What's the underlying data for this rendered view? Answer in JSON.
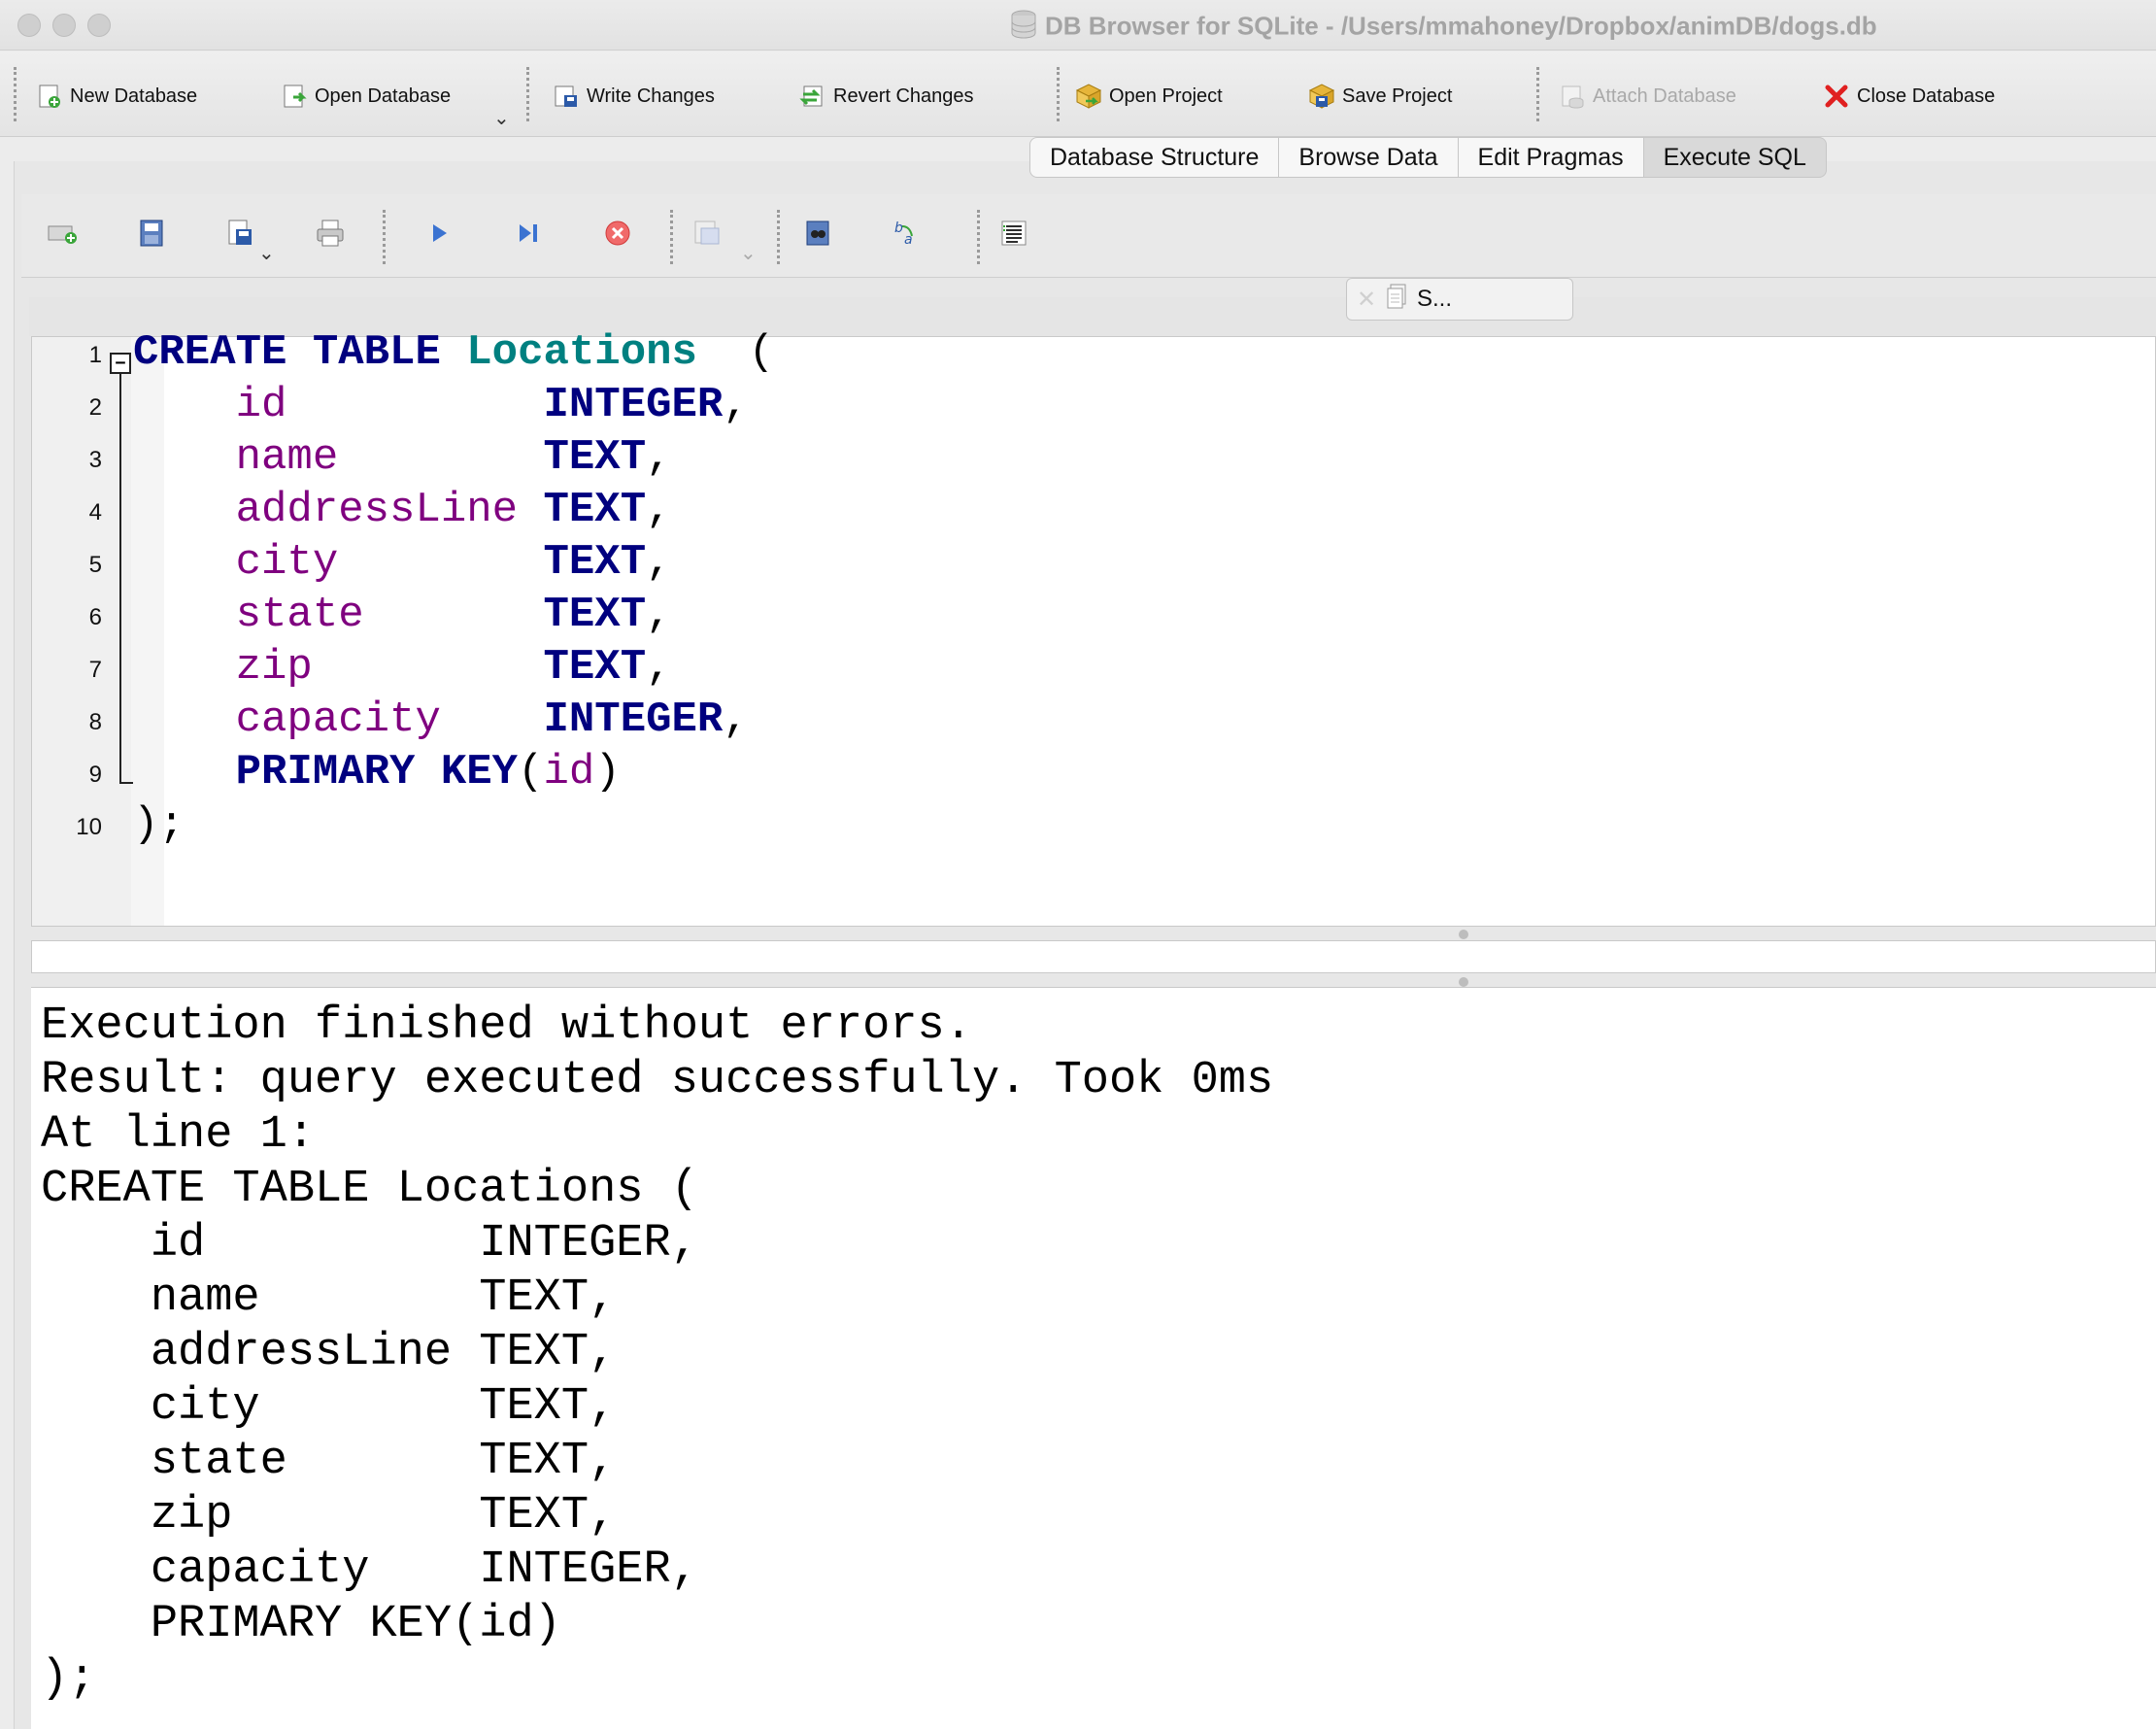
{
  "window": {
    "title": "DB Browser for SQLite - /Users/mmahoney/Dropbox/animDB/dogs.db"
  },
  "toolbar": {
    "new_database": "New Database",
    "open_database": "Open Database",
    "write_changes": "Write Changes",
    "revert_changes": "Revert Changes",
    "open_project": "Open Project",
    "save_project": "Save Project",
    "attach_database": "Attach Database",
    "close_database": "Close Database"
  },
  "tabs": [
    {
      "label": "Database Structure",
      "active": false
    },
    {
      "label": "Browse Data",
      "active": false
    },
    {
      "label": "Edit Pragmas",
      "active": false
    },
    {
      "label": "Execute SQL",
      "active": true
    }
  ],
  "editor": {
    "tab_label": "S...",
    "line_numbers": [
      "1",
      "2",
      "3",
      "4",
      "5",
      "6",
      "7",
      "8",
      "9",
      "10"
    ],
    "code": [
      [
        {
          "t": "CREATE",
          "c": "kw"
        },
        {
          "t": " ",
          "c": "pn"
        },
        {
          "t": "TABLE",
          "c": "kw"
        },
        {
          "t": " ",
          "c": "pn"
        },
        {
          "t": "Locations",
          "c": "tbl"
        },
        {
          "t": "  (",
          "c": "pn"
        }
      ],
      [
        {
          "t": "    ",
          "c": "pn"
        },
        {
          "t": "id",
          "c": "col"
        },
        {
          "t": "          ",
          "c": "pn"
        },
        {
          "t": "INTEGER",
          "c": "kw"
        },
        {
          "t": ",",
          "c": "pn"
        }
      ],
      [
        {
          "t": "    ",
          "c": "pn"
        },
        {
          "t": "name",
          "c": "col"
        },
        {
          "t": "        ",
          "c": "pn"
        },
        {
          "t": "TEXT",
          "c": "kw"
        },
        {
          "t": ",",
          "c": "pn"
        }
      ],
      [
        {
          "t": "    ",
          "c": "pn"
        },
        {
          "t": "addressLine",
          "c": "col"
        },
        {
          "t": " ",
          "c": "pn"
        },
        {
          "t": "TEXT",
          "c": "kw"
        },
        {
          "t": ",",
          "c": "pn"
        }
      ],
      [
        {
          "t": "    ",
          "c": "pn"
        },
        {
          "t": "city",
          "c": "col"
        },
        {
          "t": "        ",
          "c": "pn"
        },
        {
          "t": "TEXT",
          "c": "kw"
        },
        {
          "t": ",",
          "c": "pn"
        }
      ],
      [
        {
          "t": "    ",
          "c": "pn"
        },
        {
          "t": "state",
          "c": "col"
        },
        {
          "t": "       ",
          "c": "pn"
        },
        {
          "t": "TEXT",
          "c": "kw"
        },
        {
          "t": ",",
          "c": "pn"
        }
      ],
      [
        {
          "t": "    ",
          "c": "pn"
        },
        {
          "t": "zip",
          "c": "col"
        },
        {
          "t": "         ",
          "c": "pn"
        },
        {
          "t": "TEXT",
          "c": "kw"
        },
        {
          "t": ",",
          "c": "pn"
        }
      ],
      [
        {
          "t": "    ",
          "c": "pn"
        },
        {
          "t": "capacity",
          "c": "col"
        },
        {
          "t": "    ",
          "c": "pn"
        },
        {
          "t": "INTEGER",
          "c": "kw"
        },
        {
          "t": ",",
          "c": "pn"
        }
      ],
      [
        {
          "t": "    ",
          "c": "pn"
        },
        {
          "t": "PRIMARY",
          "c": "kw"
        },
        {
          "t": " ",
          "c": "pn"
        },
        {
          "t": "KEY",
          "c": "kw"
        },
        {
          "t": "(",
          "c": "pn"
        },
        {
          "t": "id",
          "c": "col"
        },
        {
          "t": ")",
          "c": "pn"
        }
      ],
      [
        {
          "t": ");",
          "c": "pn"
        }
      ]
    ]
  },
  "result": {
    "lines": [
      "Execution finished without errors.",
      "Result: query executed successfully. Took 0ms",
      "At line 1:",
      "CREATE TABLE Locations (",
      "    id          INTEGER,",
      "    name        TEXT,",
      "    addressLine TEXT,",
      "    city        TEXT,",
      "    state       TEXT,",
      "    zip         TEXT,",
      "    capacity    INTEGER,",
      "    PRIMARY KEY(id)",
      ");"
    ]
  },
  "colors": {
    "keyword": "#00007f",
    "table_name": "#008080",
    "column_name": "#7f007f"
  }
}
